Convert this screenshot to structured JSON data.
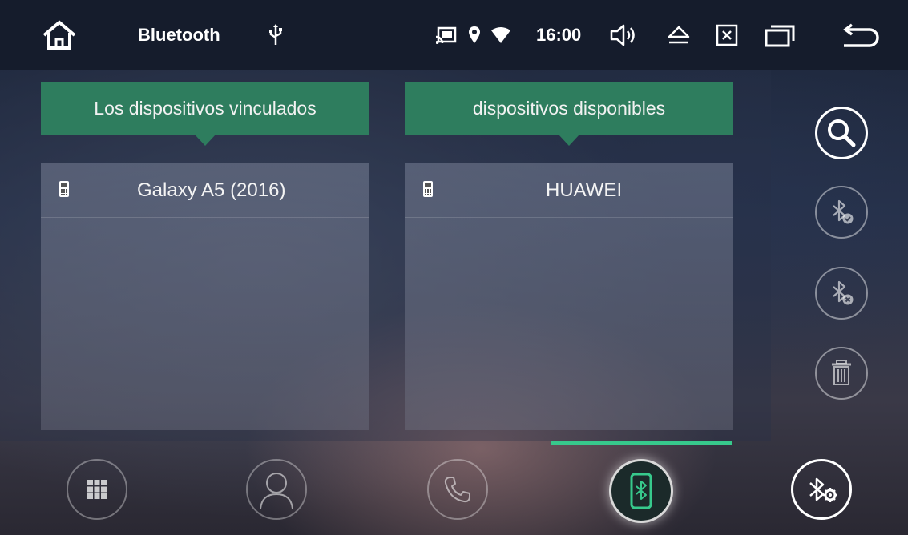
{
  "statusbar": {
    "title": "Bluetooth",
    "time": "16:00",
    "icons": [
      "home-icon",
      "usb-icon",
      "cast-icon",
      "location-icon",
      "wifi-icon",
      "volume-icon",
      "eject-icon",
      "close-box-icon",
      "recent-apps-icon",
      "back-icon"
    ]
  },
  "paired": {
    "header": "Los dispositivos vinculados",
    "devices": [
      {
        "name": "Galaxy A5 (2016)",
        "icon": "phone-icon"
      }
    ]
  },
  "available": {
    "header": "dispositivos disponibles",
    "devices": [
      {
        "name": "HUAWEI",
        "icon": "phone-icon"
      }
    ]
  },
  "side_actions": [
    "search-icon",
    "bluetooth-connect-icon",
    "bluetooth-disconnect-icon",
    "trash-icon"
  ],
  "bottom_tabs": [
    {
      "icon": "dialpad-icon",
      "active": false
    },
    {
      "icon": "contacts-icon",
      "active": false
    },
    {
      "icon": "phone-call-icon",
      "active": false
    },
    {
      "icon": "bluetooth-device-icon",
      "active": true
    },
    {
      "icon": "bluetooth-settings-icon",
      "active": false
    }
  ],
  "colors": {
    "accent": "#2e7d5e",
    "active_indicator": "#37c98c",
    "statusbar": "#151c2c"
  }
}
